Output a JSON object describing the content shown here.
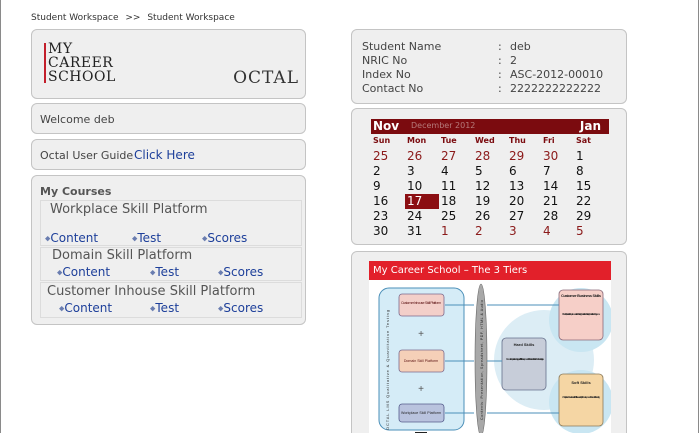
{
  "breadcrumb": {
    "first": "Student Workspace",
    "sep": ">>",
    "second": "Student Workspace"
  },
  "logo": {
    "line1": "MY",
    "line2": "CAREER",
    "line3": "SCHOOL",
    "brand": "OCTAL",
    "accent": "#c31f2b"
  },
  "welcome": {
    "text": "Welcome deb"
  },
  "guide": {
    "label": "Octal User Guide",
    "link": "Click Here"
  },
  "courses": {
    "title": "My Courses",
    "items": [
      {
        "name": "Workplace Skill Platform",
        "links": [
          "Content",
          "Test",
          "Scores"
        ]
      },
      {
        "name": "Domain Skill Platform",
        "links": [
          "Content",
          "Test",
          "Scores"
        ]
      },
      {
        "name": "Customer Inhouse Skill Platform",
        "links": [
          "Content",
          "Test",
          "Scores"
        ]
      }
    ]
  },
  "student": {
    "rows": [
      {
        "label": "Student Name",
        "value": "deb"
      },
      {
        "label": "NRIC No",
        "value": "2"
      },
      {
        "label": "Index No",
        "value": "ASC-2012-00010"
      },
      {
        "label": "Contact No",
        "value": "2222222222222"
      }
    ]
  },
  "calendar": {
    "prev": "Nov",
    "current": "December 2012",
    "next": "Jan",
    "days": [
      "Sun",
      "Mon",
      "Tue",
      "Wed",
      "Thu",
      "Fri",
      "Sat"
    ],
    "weeks": [
      [
        "25",
        "26",
        "27",
        "28",
        "29",
        "30",
        "1"
      ],
      [
        "2",
        "3",
        "4",
        "5",
        "6",
        "7",
        "8"
      ],
      [
        "9",
        "10",
        "11",
        "12",
        "13",
        "14",
        "15"
      ],
      [
        "16",
        "17",
        "18",
        "19",
        "20",
        "21",
        "22"
      ],
      [
        "23",
        "24",
        "25",
        "26",
        "27",
        "28",
        "29"
      ],
      [
        "30",
        "31",
        "1",
        "2",
        "3",
        "4",
        "5"
      ]
    ],
    "today": "17",
    "accent": "#7b0b0f"
  },
  "tiers": {
    "title": "My Career School – The 3 Tiers",
    "diagram": {
      "left_boxes": [
        "Customer Inhouse Skill Platform",
        "Domain Skill Platform",
        "Workplace Skill Platform"
      ],
      "vertical_left": "OCTAL LMS Qualitative & Quantitative Testing",
      "vertical_mid": "Contents: Presentation, Spreadsheet, PDF, HTML & Audio",
      "center_title": "Hard Skills",
      "center_items": "Domain Expertise Industry specific Skill Development Professional Practice Methodologies",
      "right_top_title": "Customer Business Skills",
      "right_top_items": "Product, Service Info Implementation Practicing Guidelines Statutory Guidelines Programs",
      "right_bottom_title": "Soft Skills",
      "right_bottom_items": "Workplace Readiness Life Skills Leadership Development Personal Branding"
    }
  }
}
